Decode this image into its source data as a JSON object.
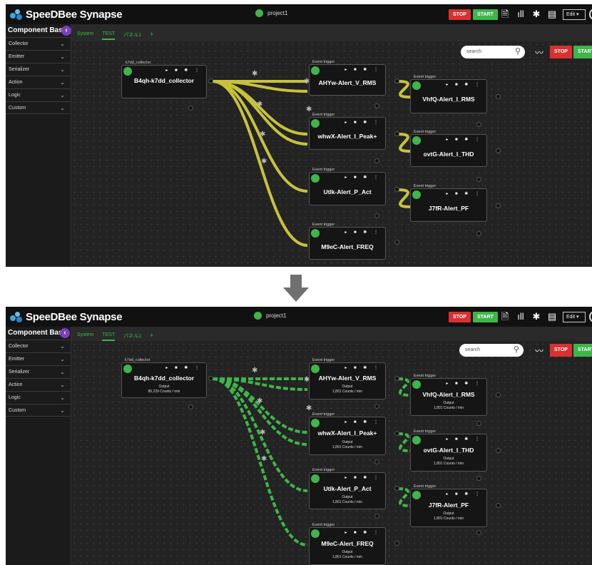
{
  "app": {
    "name": "SpeeDBee Synapse",
    "project": "project1"
  },
  "header": {
    "stop_label": "STOP",
    "start_label": "START",
    "edit_label": "Edit ▾"
  },
  "sidebar": {
    "title": "Component Base",
    "items": [
      {
        "label": "Collector"
      },
      {
        "label": "Emitter"
      },
      {
        "label": "Serializer"
      },
      {
        "label": "Action"
      },
      {
        "label": "Logic"
      },
      {
        "label": "Custom"
      }
    ]
  },
  "tabs": [
    {
      "label": "System"
    },
    {
      "label": "TEST",
      "active": true
    },
    {
      "label": "パネル1"
    },
    {
      "label": "+"
    }
  ],
  "canvas": {
    "search_placeholder": "search",
    "stop_label": "STOP",
    "start_label": "START"
  },
  "nodes": [
    {
      "type": "k7dd_collector",
      "name": "B4qh-k7dd_collector",
      "output_label": "Output",
      "output_value": "85,229 Counts / min"
    },
    {
      "type": "Event trigger",
      "name": "AHYw-Alert_V_RMS",
      "output_label": "Output",
      "output_value": "1,801 Counts / min"
    },
    {
      "type": "Event trigger",
      "name": "whwX-Alert_I_Peak+",
      "output_label": "Output",
      "output_value": "1,801 Counts / min"
    },
    {
      "type": "Event trigger",
      "name": "Utlk-Alert_P_Act",
      "output_label": "Output",
      "output_value": "1,801 Counts / min"
    },
    {
      "type": "Event trigger",
      "name": "M9eC-Alert_FREQ",
      "output_label": "Output",
      "output_value": "1,801 Counts / min"
    },
    {
      "type": "Event trigger",
      "name": "VhfQ-Alert_I_RMS",
      "output_label": "Output",
      "output_value": "1,801 Counts / min"
    },
    {
      "type": "Event trigger",
      "name": "ovtG-Alert_I_THD",
      "output_label": "Output",
      "output_value": "1,801 Counts / min"
    },
    {
      "type": "Event trigger",
      "name": "J7fR-Alert_PF",
      "output_label": "Output",
      "output_value": "1,801 Counts / min"
    }
  ],
  "colors": {
    "link_idle": "#c8c23a",
    "link_active": "#3fb54a",
    "stop": "#d93030",
    "start": "#3fb54a",
    "accent_purple": "#7b3fbf"
  },
  "icons": {
    "header": [
      "document-icon",
      "bar-chart-icon",
      "gear-icon",
      "book-icon"
    ],
    "node_controls": [
      "play-icon",
      "stop-icon",
      "gear-icon",
      "more-icon"
    ],
    "canvas": [
      "search-icon",
      "trend-icon"
    ],
    "transition": "down-arrow-icon"
  }
}
